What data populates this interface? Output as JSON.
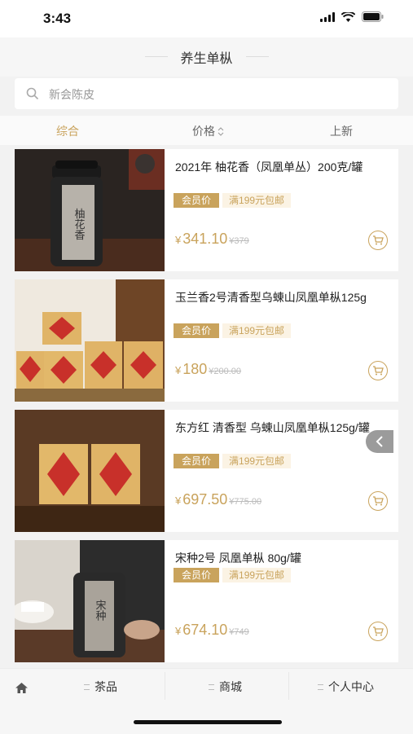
{
  "status_bar": {
    "time": "3:43"
  },
  "header": {
    "title": "养生单枞"
  },
  "search": {
    "placeholder": "新会陈皮"
  },
  "sort_tabs": [
    {
      "label": "综合",
      "active": true
    },
    {
      "label": "价格",
      "icon": "sort-updown-icon"
    },
    {
      "label": "上新"
    }
  ],
  "products": [
    {
      "name": "2021年 柚花香（凤凰单丛）200克/罐",
      "member_tag": "会员价",
      "shipping_tag": "满199元包邮",
      "currency": "¥",
      "price": "341.10",
      "original_price": "¥379",
      "image_text": "柚花香"
    },
    {
      "name": "玉兰香2号清香型乌蝀山凤凰单枞125g",
      "member_tag": "会员价",
      "shipping_tag": "满199元包邮",
      "currency": "¥",
      "price": "180",
      "original_price": "¥200.00"
    },
    {
      "name": "东方红 清香型 乌蝀山凤凰单枞125g/罐",
      "member_tag": "会员价",
      "shipping_tag": "满199元包邮",
      "currency": "¥",
      "price": "697.50",
      "original_price": "¥775.00"
    },
    {
      "name": "宋种2号 凤凰单枞 80g/罐",
      "member_tag": "会员价",
      "shipping_tag": "满199元包邮",
      "currency": "¥",
      "price": "674.10",
      "original_price": "¥749",
      "image_text": "宋种"
    }
  ],
  "tab_bar": [
    {
      "label": "",
      "icon": "home-icon"
    },
    {
      "label": "茶品",
      "icon": "menu-icon"
    },
    {
      "label": "商城",
      "icon": "menu-icon"
    },
    {
      "label": "个人中心",
      "icon": "menu-icon"
    }
  ],
  "colors": {
    "accent": "#c9a35c",
    "background": "#f2f2f2"
  }
}
